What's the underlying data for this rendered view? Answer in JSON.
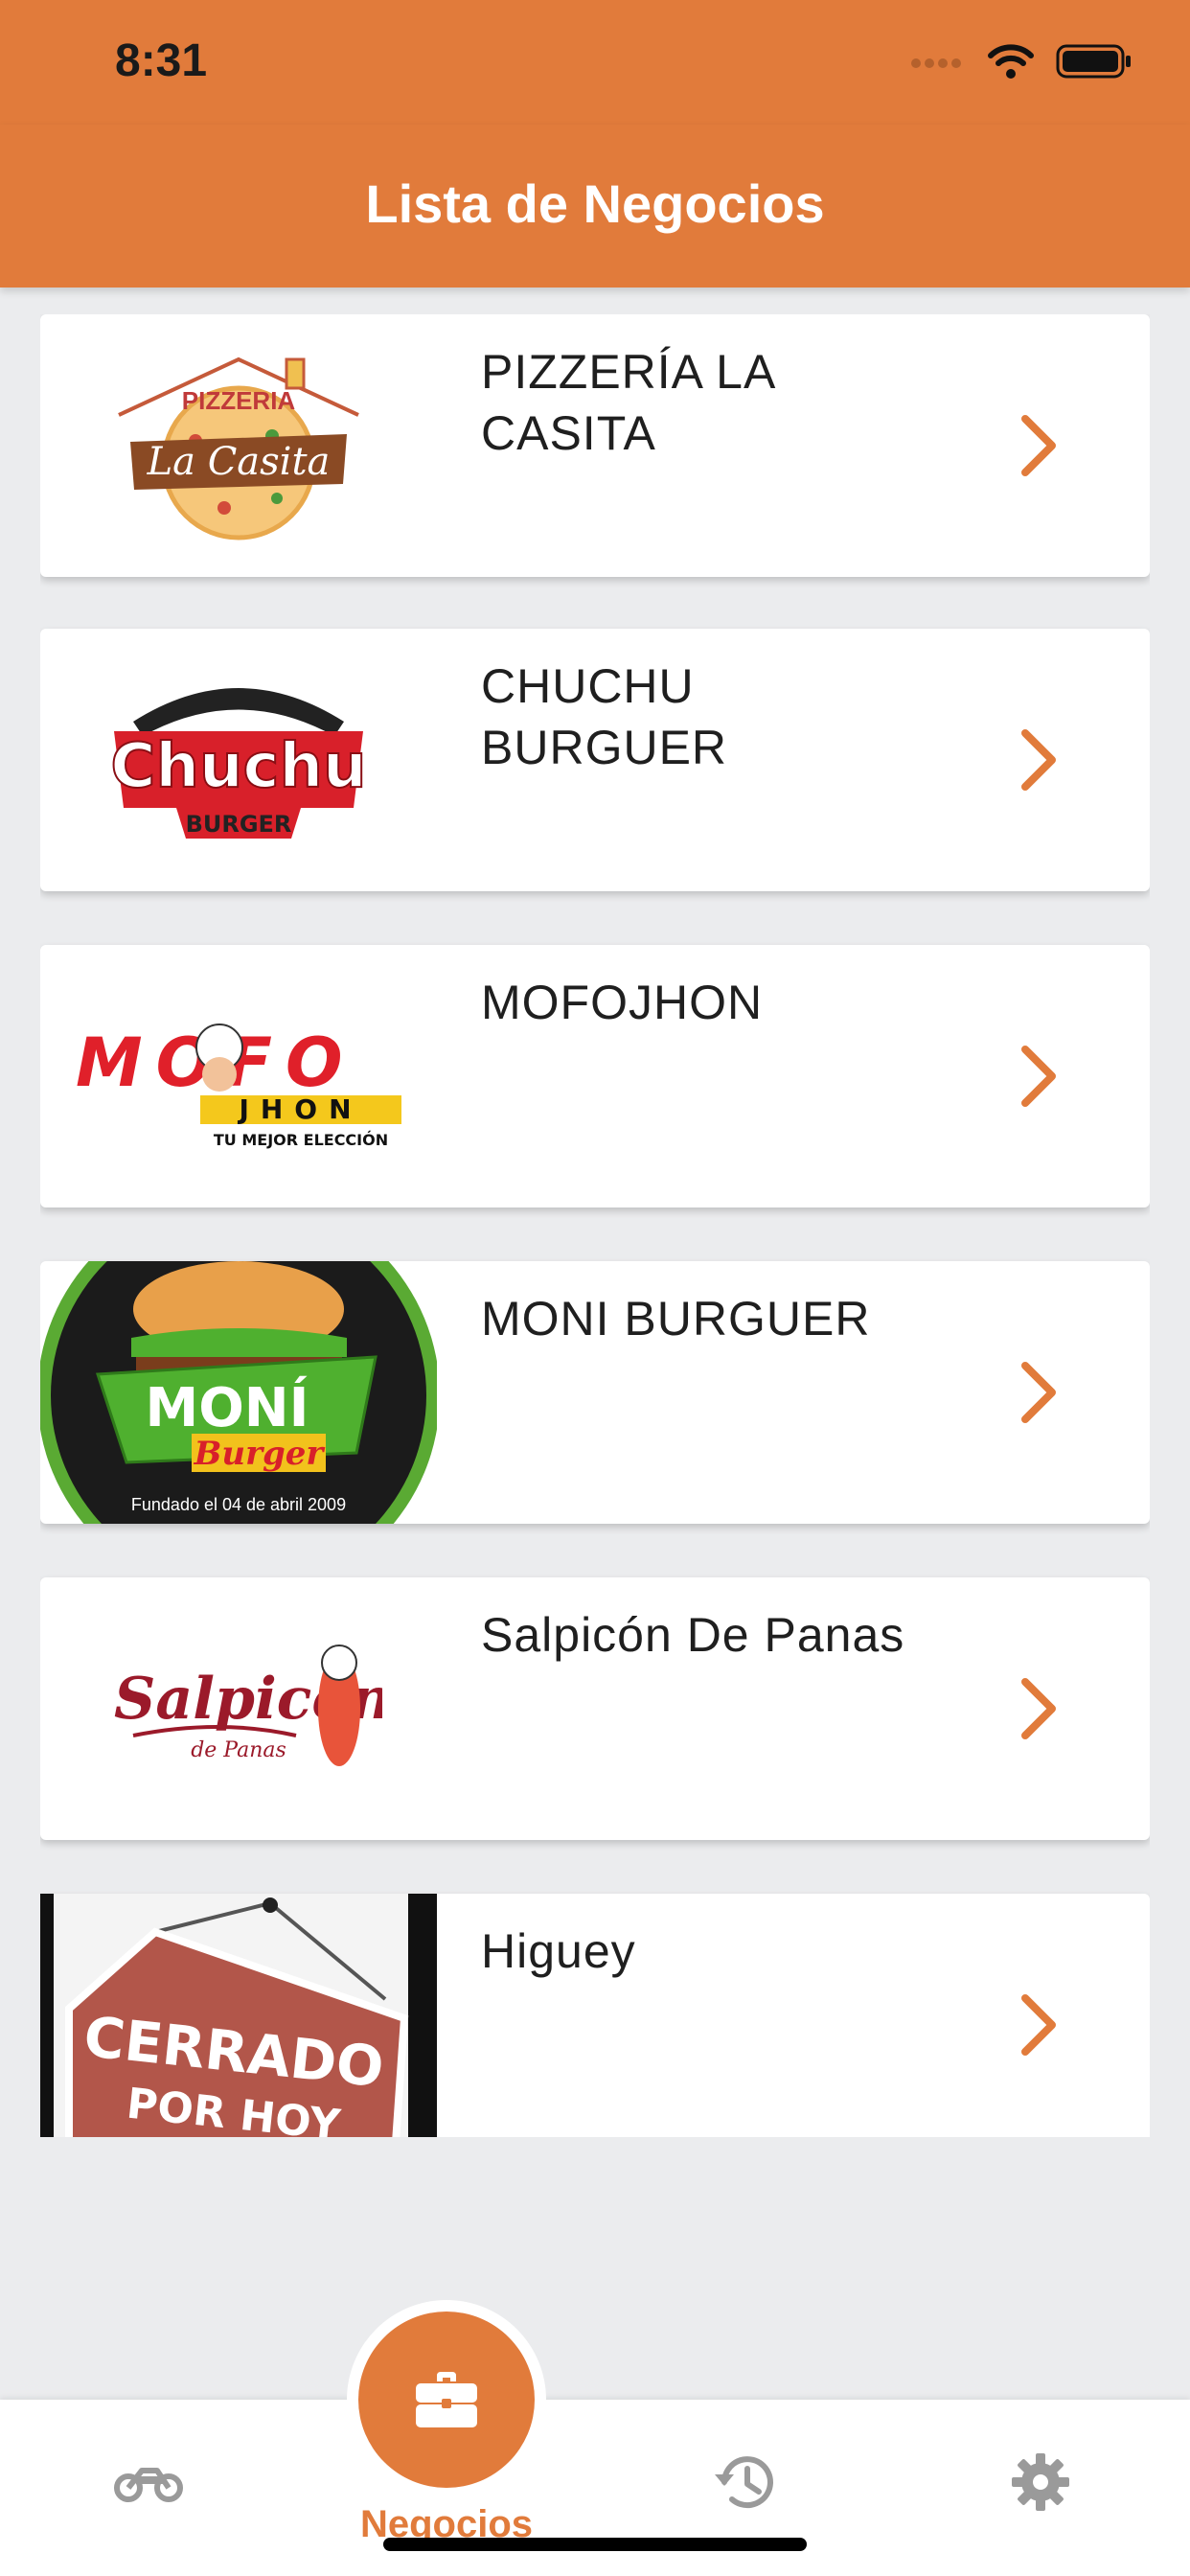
{
  "status_bar": {
    "time": "8:31"
  },
  "header": {
    "title": "Lista de Negocios"
  },
  "businesses": [
    {
      "name": "PIZZERÍA LA CASITA",
      "logo": {
        "top": "PIZZERIA",
        "main": "La Casita"
      }
    },
    {
      "name": "CHUCHU BURGUER",
      "logo": {
        "main": "Chuchu",
        "sub": "BURGER"
      }
    },
    {
      "name": "MOFOJHON",
      "logo": {
        "main": "MOFO",
        "sub": "JHON",
        "tagline": "TU MEJOR ELECCIÓN"
      }
    },
    {
      "name": "MONI BURGUER",
      "logo": {
        "main": "MONÍ",
        "sub": "Burger",
        "tagline": "Fundado el 04 de abril 2009"
      }
    },
    {
      "name": "Salpicón De Panas",
      "logo": {
        "main": "Salpicón",
        "sub": "de Panas"
      }
    },
    {
      "name": "Higuey",
      "logo": {
        "main": "CERRADO",
        "sub": "POR HOY"
      }
    }
  ],
  "tabbar": {
    "active_label": "Negocios",
    "icons": [
      "motorcycle-icon",
      "briefcase-icon",
      "history-icon",
      "gear-icon"
    ]
  },
  "colors": {
    "accent": "#e17b3b",
    "background": "#ebecee",
    "tab_inactive": "#9a9a9a"
  }
}
